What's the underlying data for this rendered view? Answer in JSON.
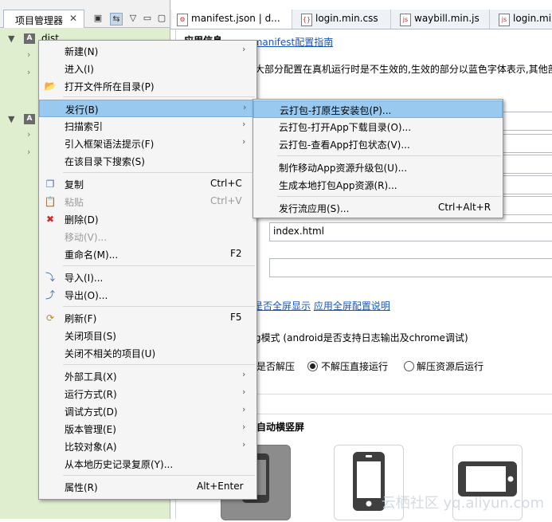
{
  "explorer": {
    "tab_label": "项目管理器",
    "close_glyph": "✕",
    "project1_name": "dist",
    "project_badge": "A"
  },
  "editor_tabs": [
    {
      "label": "manifest.json | d...",
      "icon": "file-json-icon"
    },
    {
      "label": "login.min.css",
      "icon": "file-css-icon"
    },
    {
      "label": "waybill.min.js",
      "icon": "file-js-icon"
    },
    {
      "label": "login.min...",
      "icon": "file-js-icon"
    }
  ],
  "editor": {
    "section_heading_partial": "应用信息",
    "manifest_guide_link": "manifest配置指南",
    "manifest_link_prefix": "m",
    "info_text": "大部分配置在真机运行时是不生效的,生效的部分以蓝色字体表示,其他部",
    "launch_page_value": "index.html",
    "fullscreen_label_partial": "是否全屏显示",
    "fullscreen_link": "应用全屏配置说明",
    "debug_label_partial": "g模式 (android是否支持日志输出及chrome调试)",
    "unzip_label_partial": "是否解压",
    "radio_option1": "不解压直接运行",
    "radio_option2": "解压资源后运行",
    "orientation_label_partial": "自动横竖屏",
    "watermark": "云栖社区 yq.aliyun.com"
  },
  "context_menu": {
    "items": [
      {
        "label": "新建(N)",
        "shortcut": "",
        "submenu": true
      },
      {
        "label": "进入(I)",
        "shortcut": "",
        "submenu": false
      },
      {
        "label": "打开文件所在目录(P)",
        "shortcut": "",
        "submenu": false
      },
      {
        "label": "发行(B)",
        "shortcut": "",
        "submenu": true
      },
      {
        "label": "扫描索引",
        "shortcut": "",
        "submenu": true
      },
      {
        "label": "引入框架语法提示(F)",
        "shortcut": "",
        "submenu": true
      },
      {
        "label": "在该目录下搜索(S)",
        "shortcut": "",
        "submenu": false
      },
      {
        "label": "复制",
        "shortcut": "Ctrl+C",
        "submenu": false
      },
      {
        "label": "粘贴",
        "shortcut": "Ctrl+V",
        "submenu": false
      },
      {
        "label": "删除(D)",
        "shortcut": "",
        "submenu": false
      },
      {
        "label": "移动(V)...",
        "shortcut": "",
        "submenu": false
      },
      {
        "label": "重命名(M)...",
        "shortcut": "F2",
        "submenu": false
      },
      {
        "label": "导入(I)...",
        "shortcut": "",
        "submenu": false
      },
      {
        "label": "导出(O)...",
        "shortcut": "",
        "submenu": false
      },
      {
        "label": "刷新(F)",
        "shortcut": "F5",
        "submenu": false
      },
      {
        "label": "关闭项目(S)",
        "shortcut": "",
        "submenu": false
      },
      {
        "label": "关闭不相关的项目(U)",
        "shortcut": "",
        "submenu": false
      },
      {
        "label": "外部工具(X)",
        "shortcut": "",
        "submenu": true
      },
      {
        "label": "运行方式(R)",
        "shortcut": "",
        "submenu": true
      },
      {
        "label": "调试方式(D)",
        "shortcut": "",
        "submenu": true
      },
      {
        "label": "版本管理(E)",
        "shortcut": "",
        "submenu": true
      },
      {
        "label": "比较对象(A)",
        "shortcut": "",
        "submenu": true
      },
      {
        "label": "从本地历史记录复原(Y)...",
        "shortcut": "",
        "submenu": false
      },
      {
        "label": "属性(R)",
        "shortcut": "Alt+Enter",
        "submenu": false
      }
    ]
  },
  "publish_submenu": {
    "items": [
      {
        "label": "云打包-打原生安装包(P)...",
        "shortcut": ""
      },
      {
        "label": "云打包-打开App下载目录(O)...",
        "shortcut": ""
      },
      {
        "label": "云打包-查看App打包状态(V)...",
        "shortcut": ""
      },
      {
        "label": "制作移动App资源升级包(U)...",
        "shortcut": ""
      },
      {
        "label": "生成本地打包App资源(R)...",
        "shortcut": ""
      },
      {
        "label": "发行流应用(S)...",
        "shortcut": "Ctrl+Alt+R"
      }
    ]
  },
  "colors": {
    "explorer_bg": "#dfeecf",
    "menu_highlight": "#99c9ef",
    "link": "#1a56b8"
  }
}
